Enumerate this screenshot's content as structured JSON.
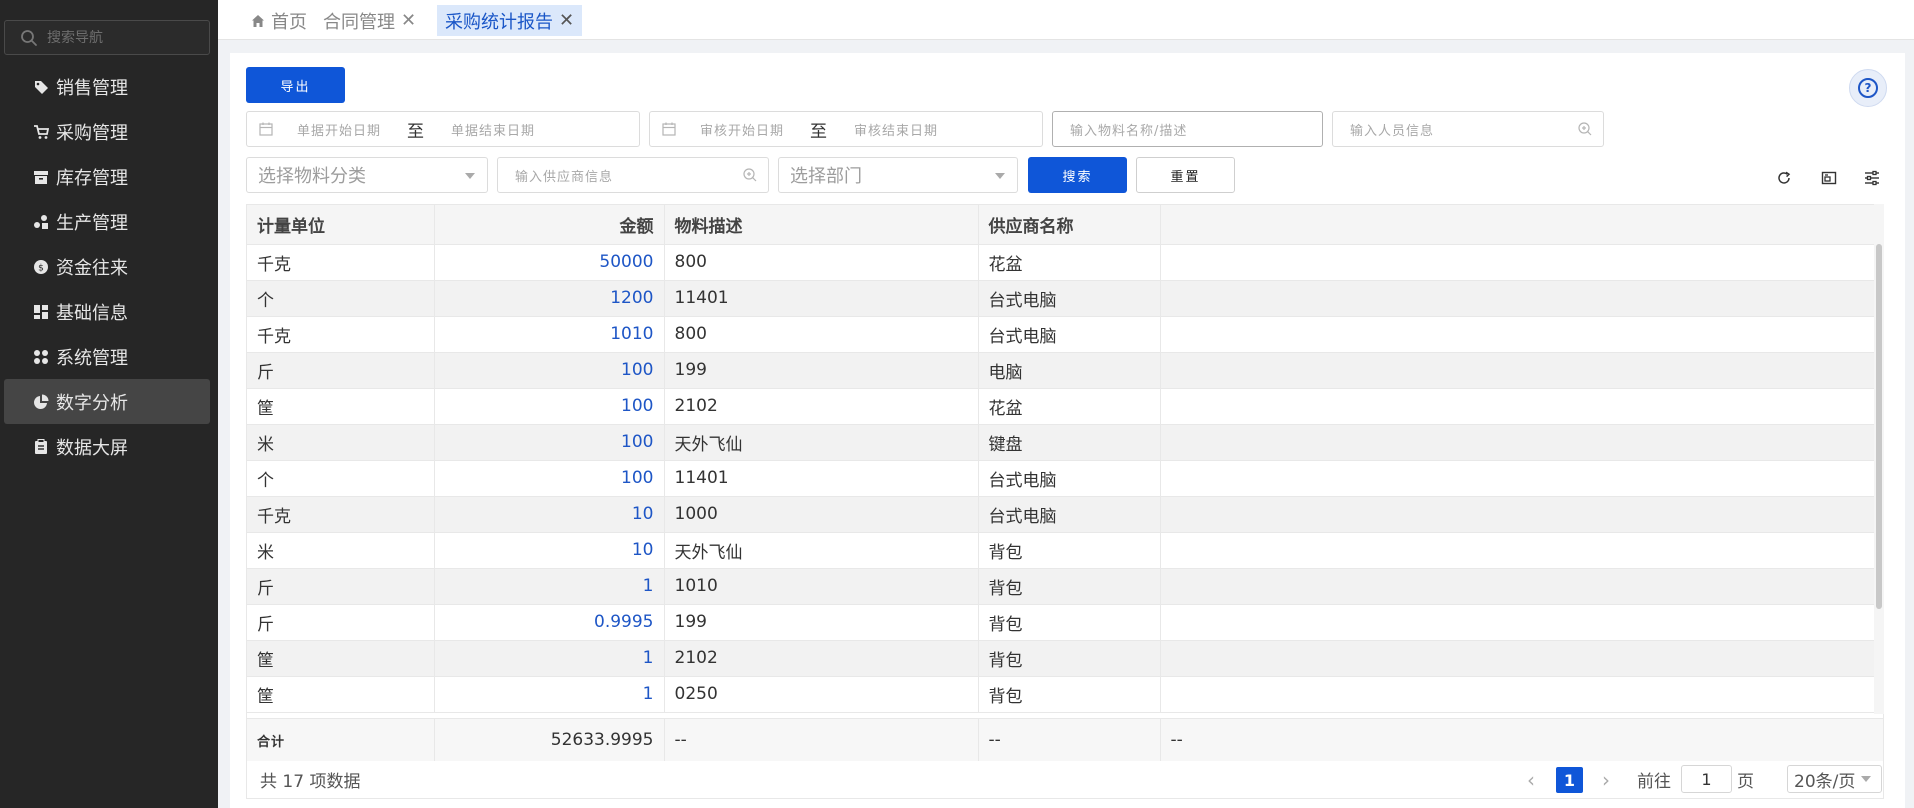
{
  "sidebar": {
    "search_placeholder": "搜索导航",
    "items": [
      {
        "label": "销售管理",
        "icon": "tag-icon",
        "active": false
      },
      {
        "label": "采购管理",
        "icon": "cart-icon",
        "active": false
      },
      {
        "label": "库存管理",
        "icon": "box-icon",
        "active": false
      },
      {
        "label": "生产管理",
        "icon": "production-icon",
        "active": false
      },
      {
        "label": "资金往来",
        "icon": "money-icon",
        "active": false
      },
      {
        "label": "基础信息",
        "icon": "grid-icon",
        "active": false
      },
      {
        "label": "系统管理",
        "icon": "apps-icon",
        "active": false
      },
      {
        "label": "数字分析",
        "icon": "pie-chart-icon",
        "active": true
      },
      {
        "label": "数据大屏",
        "icon": "clipboard-icon",
        "active": false
      }
    ]
  },
  "tabs": [
    {
      "label": "首页",
      "icon": "home-icon",
      "closable": false,
      "active": false
    },
    {
      "label": "合同管理",
      "closable": true,
      "active": false
    },
    {
      "label": "采购统计报告",
      "closable": true,
      "active": true
    }
  ],
  "toolbar": {
    "export_label": "导出",
    "help_label": "?"
  },
  "filters": {
    "doc_start_placeholder": "单据开始日期",
    "doc_to": "至",
    "doc_end_placeholder": "单据结束日期",
    "audit_start_placeholder": "审核开始日期",
    "audit_to": "至",
    "audit_end_placeholder": "审核结束日期",
    "material_placeholder": "输入物料名称/描述",
    "person_placeholder": "输入人员信息",
    "category_placeholder": "选择物料分类",
    "supplier_placeholder": "输入供应商信息",
    "department_placeholder": "选择部门",
    "search_label": "搜索",
    "reset_label": "重置"
  },
  "table": {
    "columns": [
      "计量单位",
      "金额",
      "物料描述",
      "供应商名称",
      ""
    ],
    "rows": [
      [
        "千克",
        "50000",
        "800",
        "花盆"
      ],
      [
        "个",
        "1200",
        "11401",
        "台式电脑"
      ],
      [
        "千克",
        "1010",
        "800",
        "台式电脑"
      ],
      [
        "斤",
        "100",
        "199",
        "电脑"
      ],
      [
        "筐",
        "100",
        "2102",
        "花盆"
      ],
      [
        "米",
        "100",
        "天外飞仙",
        "键盘"
      ],
      [
        "个",
        "100",
        "11401",
        "台式电脑"
      ],
      [
        "千克",
        "10",
        "1000",
        "台式电脑"
      ],
      [
        "米",
        "10",
        "天外飞仙",
        "背包"
      ],
      [
        "斤",
        "1",
        "1010",
        "背包"
      ],
      [
        "斤",
        "0.9995",
        "199",
        "背包"
      ],
      [
        "筐",
        "1",
        "2102",
        "背包"
      ],
      [
        "筐",
        "1",
        "0250",
        "背包"
      ]
    ],
    "summary": {
      "label": "合计",
      "amount": "52633.9995",
      "c3": "--",
      "c4": "--",
      "c5": "--"
    }
  },
  "pagination": {
    "total_text": "共 17 项数据",
    "current_page": "1",
    "goto_label": "前往",
    "goto_value": "1",
    "page_suffix": "页",
    "page_size": "20条/页"
  },
  "colors": {
    "primary": "#0f56d8",
    "sidebar_bg": "#262626",
    "active_tab_bg": "#dbe8fb"
  }
}
